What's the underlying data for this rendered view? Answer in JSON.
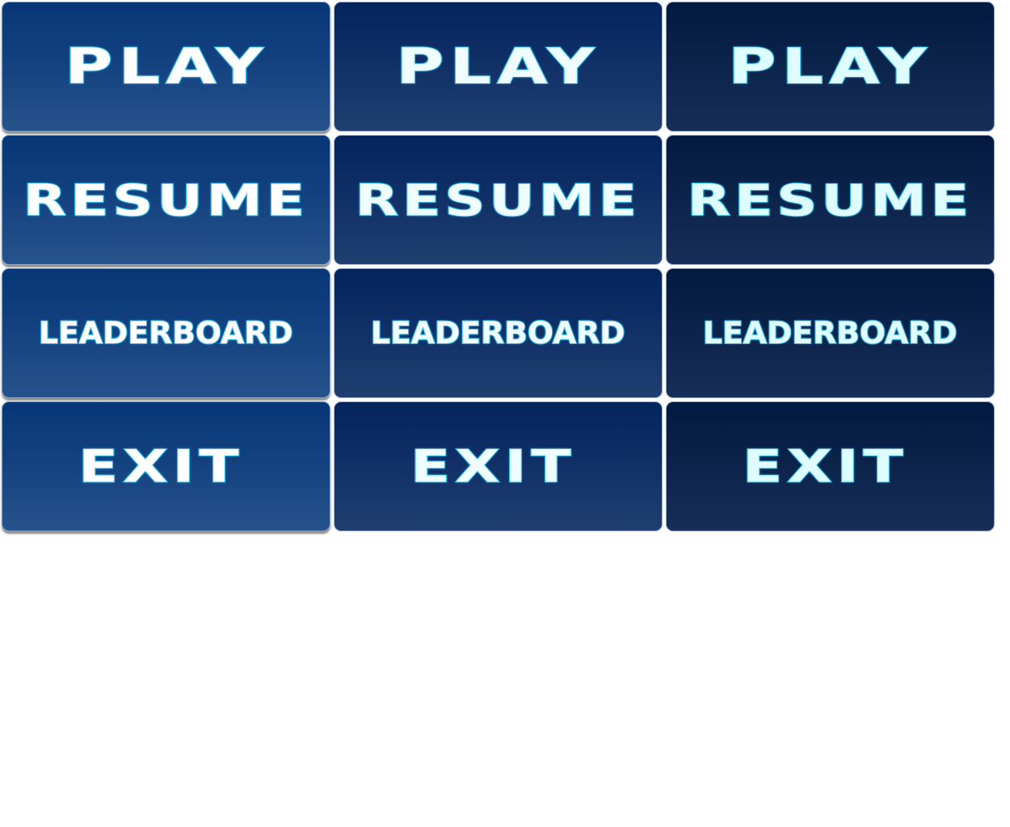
{
  "sheet": {
    "states": [
      "normal",
      "hover",
      "pressed"
    ],
    "buttons": {
      "play": "PLAY",
      "resume": "RESUME",
      "leaderboard": "LEADERBOARD",
      "exit": "EXIT"
    }
  },
  "colors": {
    "normal_top": "#073678",
    "normal_bottom": "#26538b",
    "hover_top": "#04245c",
    "hover_bottom": "#203f70",
    "pressed_top": "#031a40",
    "pressed_bottom": "#172f58",
    "text_fill": "#ffffff",
    "text_outline": "#27c2ec",
    "background": "#ffffff"
  }
}
